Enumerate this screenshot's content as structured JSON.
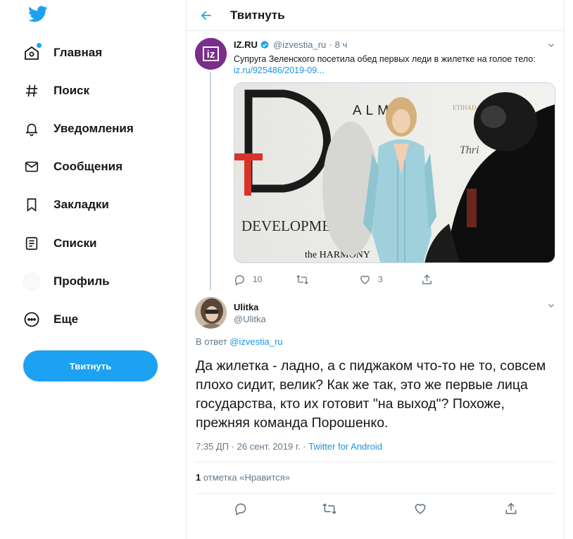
{
  "nav": {
    "items": [
      {
        "label": "Главная",
        "icon": "home-icon"
      },
      {
        "label": "Поиск",
        "icon": "hashtag-icon"
      },
      {
        "label": "Уведомления",
        "icon": "bell-icon"
      },
      {
        "label": "Сообщения",
        "icon": "envelope-icon"
      },
      {
        "label": "Закладки",
        "icon": "bookmark-icon"
      },
      {
        "label": "Списки",
        "icon": "list-icon"
      },
      {
        "label": "Профиль",
        "icon": "profile-icon"
      },
      {
        "label": "Еще",
        "icon": "more-icon"
      }
    ],
    "tweet_button": "Твитнуть"
  },
  "header": {
    "title": "Твитнуть"
  },
  "tweet1": {
    "name": "IZ.RU",
    "handle": "@izvestia_ru",
    "sep": "·",
    "time": "8 ч",
    "text": "Супруга Зеленского посетила обед первых леди в жилетке на голое тело:",
    "link": "iz.ru/925486/2019-09...",
    "avatar_text": "iz",
    "photo": {
      "sign_letter": "D",
      "sign_word": "DEVELOPMENT",
      "brand1": "ALMA",
      "brand2": "ETIHAD",
      "brand3": "the HARMONY"
    },
    "replies": "10",
    "retweets": "",
    "likes": "3"
  },
  "tweet2": {
    "name": "Ulitka",
    "handle": "@Ulitka",
    "reply_prefix": "В ответ",
    "reply_to": "@izvestia_ru",
    "text": "Да жилетка - ладно, а с пиджаком что-то не то, совсем плохо сидит, велик? Как же так, это же первые лица государства, кто их готовит \"на выход\"? Похоже, прежняя команда Порошенко.",
    "meta_time": "7:35 ДП · 26 сент. 2019 г. · ",
    "meta_source": "Twitter for Android",
    "likes_count": "1",
    "likes_label": " отметка «Нравится»"
  },
  "colors": {
    "accent": "#1da1f2",
    "brand_iz": "#7b2d8b"
  }
}
